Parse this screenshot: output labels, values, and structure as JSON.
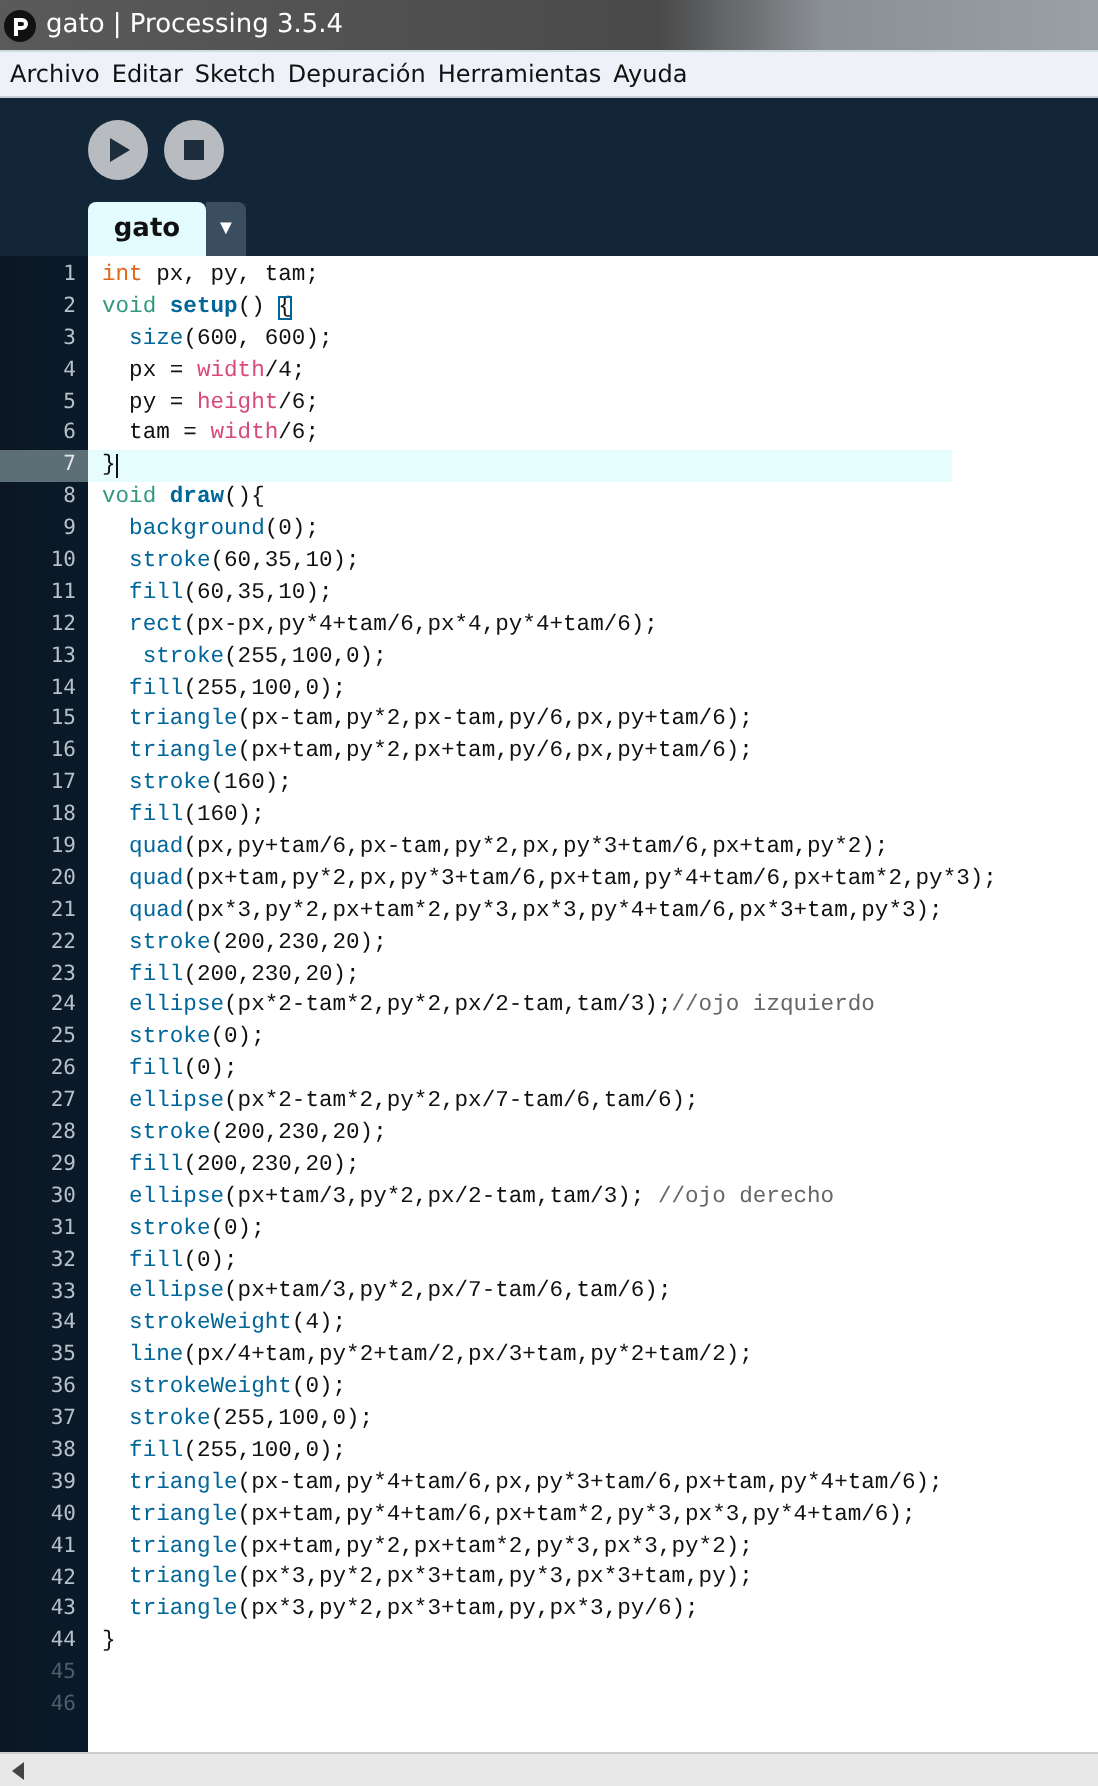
{
  "window": {
    "title": "gato | Processing 3.5.4"
  },
  "menu": [
    "Archivo",
    "Editar",
    "Sketch",
    "Depuración",
    "Herramientas",
    "Ayuda"
  ],
  "toolbar": [
    {
      "kind": "run"
    },
    {
      "kind": "stop"
    }
  ],
  "tabs": [
    {
      "label": "gato",
      "selected": true
    }
  ],
  "tab_menu": "▼",
  "code": [
    {
      "number": "1",
      "segments": [
        {
          "kind": "type",
          "text": "int"
        },
        {
          "kind": "plain",
          "text": " px, py, tam;"
        }
      ]
    },
    {
      "number": "2",
      "segments": [
        {
          "kind": "keyword",
          "text": "void "
        },
        {
          "kind": "def",
          "text": "setup"
        },
        {
          "kind": "plain",
          "text": "() "
        },
        {
          "kind": "match",
          "text": "{"
        }
      ]
    },
    {
      "number": "3",
      "segments": [
        {
          "kind": "fn",
          "text": "  size"
        },
        {
          "kind": "plain",
          "text": "(600, 600);"
        }
      ]
    },
    {
      "number": "4",
      "segments": [
        {
          "kind": "plain",
          "text": "  px = "
        },
        {
          "kind": "var",
          "text": "width"
        },
        {
          "kind": "plain",
          "text": "/4;"
        }
      ]
    },
    {
      "number": "5",
      "segments": [
        {
          "kind": "plain",
          "text": "  py = "
        },
        {
          "kind": "var",
          "text": "height"
        },
        {
          "kind": "plain",
          "text": "/6;"
        }
      ]
    },
    {
      "number": "6",
      "segments": [
        {
          "kind": "plain",
          "text": "  tam = "
        },
        {
          "kind": "var",
          "text": "width"
        },
        {
          "kind": "plain",
          "text": "/6;"
        }
      ]
    },
    {
      "number": "7",
      "current": true,
      "segments": [
        {
          "kind": "plain",
          "text": "}"
        }
      ]
    },
    {
      "number": "8",
      "segments": [
        {
          "kind": "keyword",
          "text": "void "
        },
        {
          "kind": "def",
          "text": "draw"
        },
        {
          "kind": "plain",
          "text": "(){"
        }
      ]
    },
    {
      "number": "9",
      "segments": [
        {
          "kind": "fn",
          "text": "  background"
        },
        {
          "kind": "plain",
          "text": "(0);"
        }
      ]
    },
    {
      "number": "10",
      "segments": [
        {
          "kind": "fn",
          "text": "  stroke"
        },
        {
          "kind": "plain",
          "text": "(60,35,10);"
        }
      ]
    },
    {
      "number": "11",
      "segments": [
        {
          "kind": "fn",
          "text": "  fill"
        },
        {
          "kind": "plain",
          "text": "(60,35,10);"
        }
      ]
    },
    {
      "number": "12",
      "segments": [
        {
          "kind": "fn",
          "text": "  rect"
        },
        {
          "kind": "plain",
          "text": "(px-px,py*4+tam/6,px*4,py*4+tam/6);"
        }
      ]
    },
    {
      "number": "13",
      "segments": [
        {
          "kind": "fn",
          "text": "   stroke"
        },
        {
          "kind": "plain",
          "text": "(255,100,0);"
        }
      ]
    },
    {
      "number": "14",
      "segments": [
        {
          "kind": "fn",
          "text": "  fill"
        },
        {
          "kind": "plain",
          "text": "(255,100,0);"
        }
      ]
    },
    {
      "number": "15",
      "segments": [
        {
          "kind": "fn",
          "text": "  triangle"
        },
        {
          "kind": "plain",
          "text": "(px-tam,py*2,px-tam,py/6,px,py+tam/6);"
        }
      ]
    },
    {
      "number": "16",
      "segments": [
        {
          "kind": "fn",
          "text": "  triangle"
        },
        {
          "kind": "plain",
          "text": "(px+tam,py*2,px+tam,py/6,px,py+tam/6);"
        }
      ]
    },
    {
      "number": "17",
      "segments": [
        {
          "kind": "fn",
          "text": "  stroke"
        },
        {
          "kind": "plain",
          "text": "(160);"
        }
      ]
    },
    {
      "number": "18",
      "segments": [
        {
          "kind": "fn",
          "text": "  fill"
        },
        {
          "kind": "plain",
          "text": "(160);"
        }
      ]
    },
    {
      "number": "19",
      "segments": [
        {
          "kind": "fn",
          "text": "  quad"
        },
        {
          "kind": "plain",
          "text": "(px,py+tam/6,px-tam,py*2,px,py*3+tam/6,px+tam,py*2);"
        }
      ]
    },
    {
      "number": "20",
      "segments": [
        {
          "kind": "fn",
          "text": "  quad"
        },
        {
          "kind": "plain",
          "text": "(px+tam,py*2,px,py*3+tam/6,px+tam,py*4+tam/6,px+tam*2,py*3);"
        }
      ]
    },
    {
      "number": "21",
      "segments": [
        {
          "kind": "fn",
          "text": "  quad"
        },
        {
          "kind": "plain",
          "text": "(px*3,py*2,px+tam*2,py*3,px*3,py*4+tam/6,px*3+tam,py*3);"
        }
      ]
    },
    {
      "number": "22",
      "segments": [
        {
          "kind": "fn",
          "text": "  stroke"
        },
        {
          "kind": "plain",
          "text": "(200,230,20);"
        }
      ]
    },
    {
      "number": "23",
      "segments": [
        {
          "kind": "fn",
          "text": "  fill"
        },
        {
          "kind": "plain",
          "text": "(200,230,20);"
        }
      ]
    },
    {
      "number": "24",
      "segments": [
        {
          "kind": "fn",
          "text": "  ellipse"
        },
        {
          "kind": "plain",
          "text": "(px*2-tam*2,py*2,px/2-tam,tam/3);"
        },
        {
          "kind": "comment",
          "text": "//ojo izquierdo"
        }
      ]
    },
    {
      "number": "25",
      "segments": [
        {
          "kind": "fn",
          "text": "  stroke"
        },
        {
          "kind": "plain",
          "text": "(0);"
        }
      ]
    },
    {
      "number": "26",
      "segments": [
        {
          "kind": "fn",
          "text": "  fill"
        },
        {
          "kind": "plain",
          "text": "(0);"
        }
      ]
    },
    {
      "number": "27",
      "segments": [
        {
          "kind": "fn",
          "text": "  ellipse"
        },
        {
          "kind": "plain",
          "text": "(px*2-tam*2,py*2,px/7-tam/6,tam/6);"
        }
      ]
    },
    {
      "number": "28",
      "segments": [
        {
          "kind": "fn",
          "text": "  stroke"
        },
        {
          "kind": "plain",
          "text": "(200,230,20);"
        }
      ]
    },
    {
      "number": "29",
      "segments": [
        {
          "kind": "fn",
          "text": "  fill"
        },
        {
          "kind": "plain",
          "text": "(200,230,20);"
        }
      ]
    },
    {
      "number": "30",
      "segments": [
        {
          "kind": "fn",
          "text": "  ellipse"
        },
        {
          "kind": "plain",
          "text": "(px+tam/3,py*2,px/2-tam,tam/3); "
        },
        {
          "kind": "comment",
          "text": "//ojo derecho"
        }
      ]
    },
    {
      "number": "31",
      "segments": [
        {
          "kind": "fn",
          "text": "  stroke"
        },
        {
          "kind": "plain",
          "text": "(0);"
        }
      ]
    },
    {
      "number": "32",
      "segments": [
        {
          "kind": "fn",
          "text": "  fill"
        },
        {
          "kind": "plain",
          "text": "(0);"
        }
      ]
    },
    {
      "number": "33",
      "segments": [
        {
          "kind": "fn",
          "text": "  ellipse"
        },
        {
          "kind": "plain",
          "text": "(px+tam/3,py*2,px/7-tam/6,tam/6);"
        }
      ]
    },
    {
      "number": "34",
      "segments": [
        {
          "kind": "fn",
          "text": "  strokeWeight"
        },
        {
          "kind": "plain",
          "text": "(4);"
        }
      ]
    },
    {
      "number": "35",
      "segments": [
        {
          "kind": "fn",
          "text": "  line"
        },
        {
          "kind": "plain",
          "text": "(px/4+tam,py*2+tam/2,px/3+tam,py*2+tam/2);"
        }
      ]
    },
    {
      "number": "36",
      "segments": [
        {
          "kind": "fn",
          "text": "  strokeWeight"
        },
        {
          "kind": "plain",
          "text": "(0);"
        }
      ]
    },
    {
      "number": "37",
      "segments": [
        {
          "kind": "fn",
          "text": "  stroke"
        },
        {
          "kind": "plain",
          "text": "(255,100,0);"
        }
      ]
    },
    {
      "number": "38",
      "segments": [
        {
          "kind": "fn",
          "text": "  fill"
        },
        {
          "kind": "plain",
          "text": "(255,100,0);"
        }
      ]
    },
    {
      "number": "39",
      "segments": [
        {
          "kind": "fn",
          "text": "  triangle"
        },
        {
          "kind": "plain",
          "text": "(px-tam,py*4+tam/6,px,py*3+tam/6,px+tam,py*4+tam/6);"
        }
      ]
    },
    {
      "number": "40",
      "segments": [
        {
          "kind": "fn",
          "text": "  triangle"
        },
        {
          "kind": "plain",
          "text": "(px+tam,py*4+tam/6,px+tam*2,py*3,px*3,py*4+tam/6);"
        }
      ]
    },
    {
      "number": "41",
      "segments": [
        {
          "kind": "fn",
          "text": "  triangle"
        },
        {
          "kind": "plain",
          "text": "(px+tam,py*2,px+tam*2,py*3,px*3,py*2);"
        }
      ]
    },
    {
      "number": "42",
      "segments": [
        {
          "kind": "fn",
          "text": "  triangle"
        },
        {
          "kind": "plain",
          "text": "(px*3,py*2,px*3+tam,py*3,px*3+tam,py);"
        }
      ]
    },
    {
      "number": "43",
      "segments": [
        {
          "kind": "fn",
          "text": "  triangle"
        },
        {
          "kind": "plain",
          "text": "(px*3,py*2,px*3+tam,py,px*3,py/6);"
        }
      ]
    },
    {
      "number": "44",
      "segments": [
        {
          "kind": "plain",
          "text": "}"
        }
      ]
    },
    {
      "number": "45",
      "past_end": true
    },
    {
      "number": "46",
      "past_end": true
    }
  ]
}
